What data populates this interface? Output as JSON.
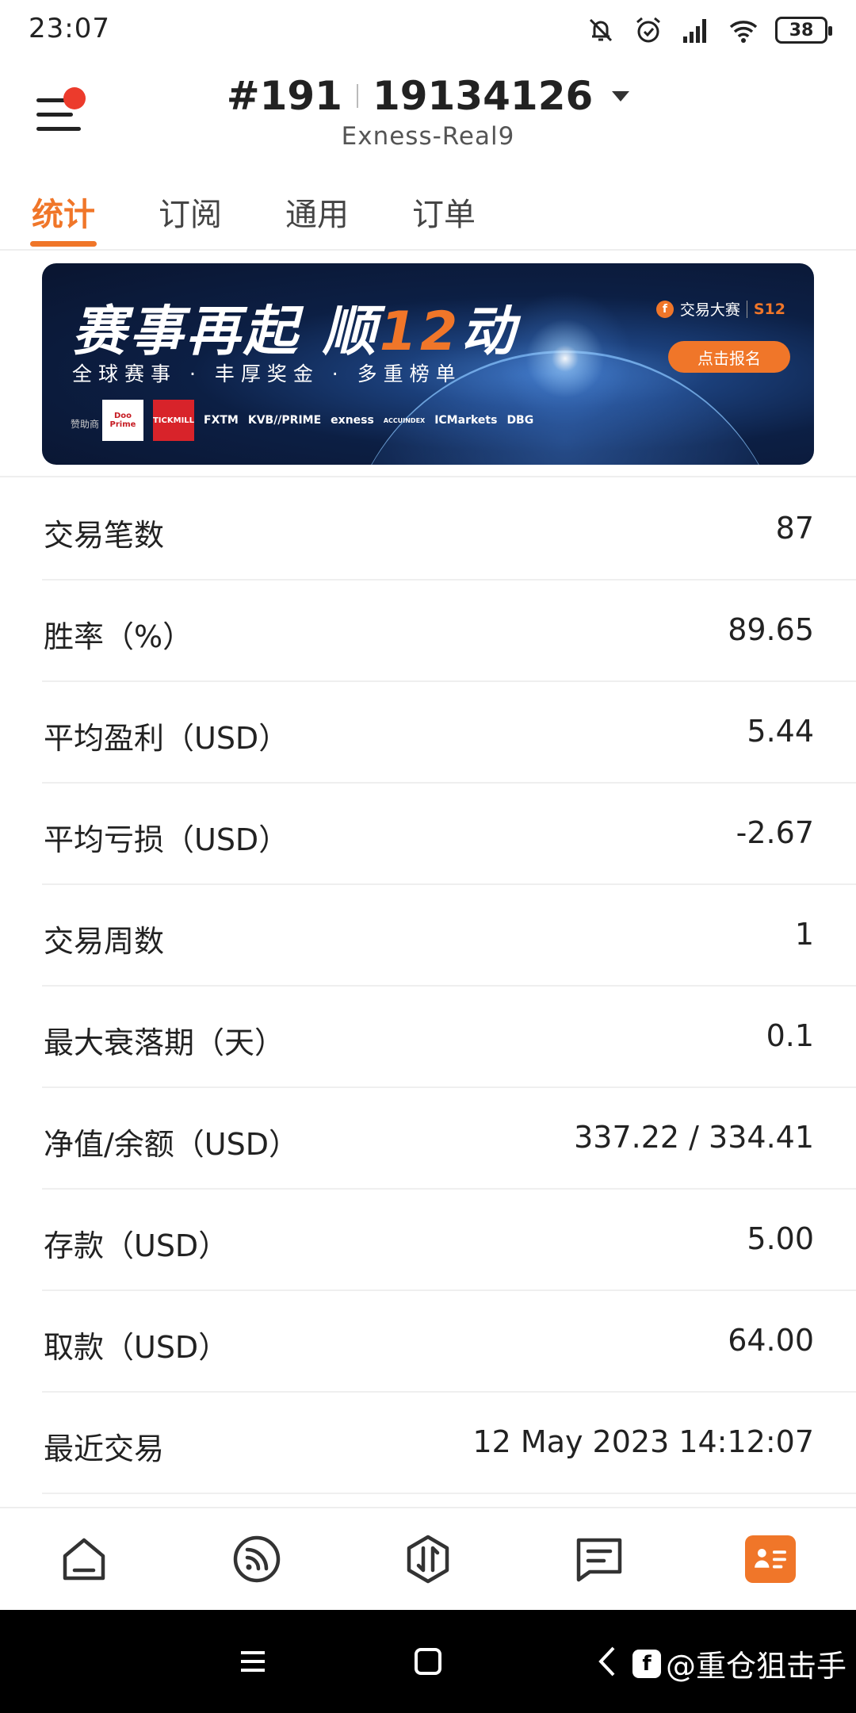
{
  "status_bar": {
    "time": "23:07",
    "battery": "38",
    "icons": [
      "mute-icon",
      "alarm-icon",
      "signal-icon",
      "wifi-icon",
      "battery-icon"
    ]
  },
  "header": {
    "account_prefix": "#191",
    "account_number": "19134126",
    "server": "Exness-Real9"
  },
  "tabs": [
    {
      "label": "统计",
      "active": true
    },
    {
      "label": "订阅",
      "active": false
    },
    {
      "label": "通用",
      "active": false
    },
    {
      "label": "订单",
      "active": false
    }
  ],
  "banner": {
    "headline_a": "赛事再起 顺",
    "headline_b": "12",
    "headline_c": "动",
    "subtitle": "全球赛事 · 丰厚奖金 · 多重榜单",
    "sponsor_label": "赞助商",
    "sponsors": [
      "Doo Prime",
      "TICKMILL",
      "FXTM",
      "KVB//PRIME",
      "exness",
      "ACCUINDEX",
      "ICMarkets",
      "DBG"
    ],
    "contest_name": "交易大赛",
    "season": "S12",
    "signup": "点击报名"
  },
  "stats": [
    {
      "label": "交易笔数",
      "value": "87"
    },
    {
      "label": "胜率（%）",
      "value": "89.65"
    },
    {
      "label": "平均盈利（USD）",
      "value": "5.44"
    },
    {
      "label": "平均亏损（USD）",
      "value": "-2.67"
    },
    {
      "label": "交易周数",
      "value": "1"
    },
    {
      "label": "最大衰落期（天）",
      "value": "0.1"
    },
    {
      "label": "净值/余额（USD）",
      "value": "337.22 / 334.41"
    },
    {
      "label": "存款（USD）",
      "value": "5.00"
    },
    {
      "label": "取款（USD）",
      "value": "64.00"
    },
    {
      "label": "最近交易",
      "value": "12 May 2023 14:12:07"
    }
  ],
  "bottom_nav": [
    "home-icon",
    "feed-icon",
    "trade-icon",
    "news-icon",
    "profile-card-icon"
  ],
  "watermark": "@重仓狙击手",
  "colors": {
    "accent": "#f07629",
    "badge": "#ec3b2c"
  }
}
